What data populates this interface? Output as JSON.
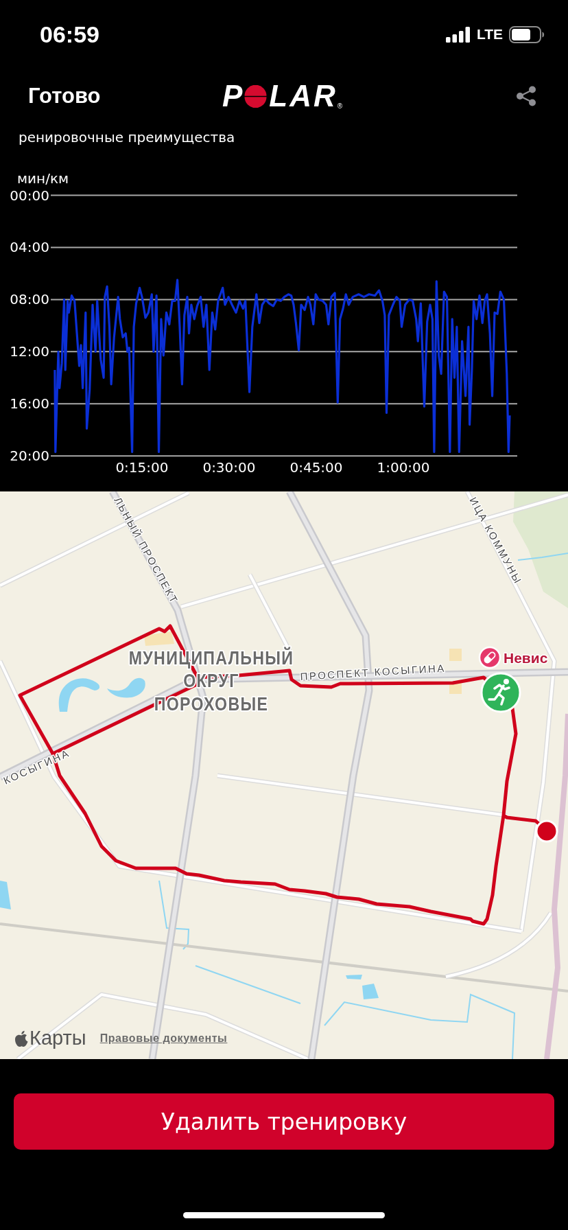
{
  "status_bar": {
    "time": "06:59",
    "network": "LTE"
  },
  "header": {
    "done": "Готово",
    "logo": {
      "left": "P",
      "right": "LAR",
      "registered": "®"
    }
  },
  "section_title": "ренировочные преимущества",
  "pace_chart": {
    "chart_data": {
      "type": "line",
      "ylabel": "мин/км",
      "grid": true,
      "x": [
        0,
        0.1,
        0.6,
        0.8,
        1.2,
        1.6,
        1.8,
        2.2,
        2.4,
        2.9,
        3.4,
        3.8,
        4.2,
        4.5,
        4.8,
        5.3,
        5.5,
        6.0,
        6.5,
        7.0,
        7.3,
        7.9,
        8.4,
        8.6,
        9.0,
        9.4,
        9.7,
        10.2,
        10.9,
        11.2,
        11.7,
        12.2,
        12.5,
        12.8,
        13.3,
        13.6,
        14.0,
        14.6,
        15.0,
        15.6,
        16.1,
        16.7,
        17.0,
        17.5,
        17.9,
        18.3,
        18.7,
        19.2,
        19.7,
        20.2,
        20.7,
        21.1,
        21.5,
        21.9,
        22.3,
        22.8,
        23.1,
        23.5,
        24.0,
        24.5,
        25.1,
        25.6,
        26.1,
        26.6,
        27.1,
        27.6,
        28.1,
        28.9,
        29.3,
        29.9,
        30.5,
        31.2,
        31.8,
        32.4,
        32.8,
        33.5,
        34.0,
        34.7,
        35.2,
        35.7,
        36.3,
        36.9,
        37.6,
        38.2,
        38.9,
        39.5,
        40.2,
        40.7,
        41.1,
        41.5,
        42.0,
        42.4,
        43.0,
        43.6,
        44.0,
        44.5,
        44.9,
        45.4,
        46.1,
        46.7,
        47.1,
        47.6,
        48.2,
        48.7,
        49.1,
        49.6,
        50.1,
        50.6,
        51.3,
        52.3,
        53.2,
        54.1,
        55.1,
        55.8,
        56.4,
        56.8,
        57.1,
        57.5,
        58.2,
        58.8,
        59.4,
        59.7,
        60.3,
        61.0,
        61.6,
        62.2,
        62.5,
        63.0,
        63.6,
        64.1,
        64.6,
        65.0,
        65.3,
        65.7,
        66.1,
        66.5,
        67.0,
        67.5,
        68.0,
        68.4,
        68.8,
        69.2,
        69.6,
        70.1,
        70.7,
        71.2,
        71.4,
        71.8,
        72.1,
        72.6,
        73.1,
        73.6,
        74.0,
        74.4,
        74.9,
        75.3,
        75.7,
        76.2,
        76.7,
        77.3,
        77.8,
        78.1,
        78.3
      ],
      "series": [
        {
          "color": "#0b2fd6",
          "values": [
            13.4,
            19.7,
            12.0,
            14.8,
            12.9,
            8.0,
            13.4,
            8.1,
            9.0,
            7.7,
            8.1,
            10.6,
            13.1,
            11.5,
            14.8,
            9.0,
            17.9,
            14.9,
            8.4,
            12.0,
            8.1,
            12.6,
            14.0,
            7.8,
            7.0,
            10.1,
            14.5,
            10.9,
            7.8,
            9.5,
            10.9,
            10.6,
            12.0,
            11.7,
            19.7,
            10.1,
            8.3,
            7.1,
            7.8,
            9.4,
            9.0,
            7.6,
            12.0,
            7.7,
            19.7,
            9.5,
            12.3,
            9.0,
            9.9,
            8.1,
            8.1,
            6.5,
            10.1,
            14.5,
            9.2,
            7.8,
            10.6,
            8.4,
            9.5,
            8.5,
            7.8,
            10.1,
            8.4,
            13.4,
            9.0,
            10.3,
            8.1,
            7.1,
            8.4,
            7.8,
            8.4,
            9.0,
            8.1,
            8.7,
            8.1,
            15.1,
            10.1,
            7.6,
            9.8,
            8.4,
            8.0,
            8.3,
            8.5,
            8.0,
            8.1,
            7.8,
            7.6,
            7.7,
            8.4,
            9.8,
            11.9,
            8.4,
            8.8,
            7.8,
            8.4,
            9.9,
            7.6,
            8.0,
            8.1,
            8.4,
            9.9,
            7.8,
            7.5,
            15.9,
            9.5,
            8.7,
            7.6,
            8.4,
            7.8,
            7.6,
            7.8,
            7.6,
            7.7,
            7.3,
            8.1,
            9.2,
            16.7,
            9.2,
            8.4,
            7.8,
            8.1,
            10.1,
            8.4,
            8.0,
            8.1,
            9.5,
            11.2,
            8.3,
            16.2,
            9.7,
            8.4,
            9.5,
            19.7,
            6.6,
            12.3,
            13.7,
            7.4,
            7.8,
            19.7,
            9.5,
            14.0,
            10.1,
            19.7,
            11.2,
            15.4,
            10.1,
            17.6,
            13.4,
            8.1,
            9.5,
            7.7,
            9.8,
            8.1,
            7.6,
            10.6,
            15.4,
            9.0,
            9.1,
            7.4,
            8.0,
            13.7,
            19.7,
            16.9
          ]
        }
      ],
      "xlim": [
        -0.7,
        79.6
      ],
      "ylim": [
        20,
        0
      ],
      "xticks": [
        {
          "value": 15,
          "label": "0:15:00"
        },
        {
          "value": 30,
          "label": "0:30:00"
        },
        {
          "value": 45,
          "label": "0:45:00"
        },
        {
          "value": 60,
          "label": "1:00:00"
        }
      ],
      "yticks": [
        {
          "value": 0,
          "label": "00:00"
        },
        {
          "value": 4,
          "label": "04:00"
        },
        {
          "value": 8,
          "label": "08:00"
        },
        {
          "value": 12,
          "label": "12:00"
        },
        {
          "value": 16,
          "label": "16:00"
        },
        {
          "value": 20,
          "label": "20:00"
        }
      ]
    }
  },
  "map": {
    "street_labels": [
      "ЛЬНЫЙ ПРОСПЕКТ",
      "ИЦА КОММУНЫ",
      "ПРОСПЕКТ КОСЫГИНА",
      "КОСЫГИНА"
    ],
    "district_lines": [
      "МУНИЦИПАЛЬНЫЙ",
      "ОКРУГ",
      "ПОРОХОВЫЕ"
    ],
    "place_label": "Невис",
    "attribution": "Карты",
    "legal_link": "Правовые документы"
  },
  "delete_button": "Удалить тренировку"
}
